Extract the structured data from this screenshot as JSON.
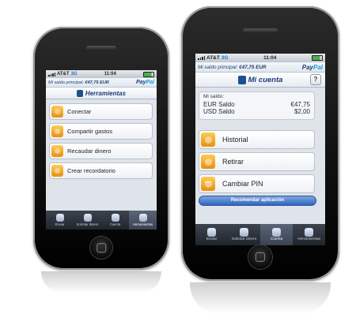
{
  "left_phone": {
    "status": {
      "carrier": "AT&T",
      "network": "3G",
      "time": "11:04"
    },
    "balance": {
      "label": "Mi saldo principal:",
      "amount": "€47,75 EUR"
    },
    "paypal": {
      "part1": "Pay",
      "part2": "Pal"
    },
    "title": "Herramientas",
    "menu": [
      {
        "label": "Conectar",
        "icon": "connect-icon"
      },
      {
        "label": "Compartir gastos",
        "icon": "share-icon"
      },
      {
        "label": "Recaudar dinero",
        "icon": "collect-icon"
      },
      {
        "label": "Crear recordatorio",
        "icon": "reminder-icon"
      }
    ],
    "tabs": [
      {
        "label": "Enviar",
        "icon": "send-icon"
      },
      {
        "label": "Solicitar dinero",
        "icon": "request-icon"
      },
      {
        "label": "Cuenta",
        "icon": "account-icon"
      },
      {
        "label": "Herramientas",
        "icon": "tools-icon",
        "active": true
      }
    ]
  },
  "right_phone": {
    "status": {
      "carrier": "AT&T",
      "network": "3G",
      "time": "11:04"
    },
    "balance": {
      "label": "Mi saldo principal:",
      "amount": "€47,75 EUR"
    },
    "paypal": {
      "part1": "Pay",
      "part2": "Pal"
    },
    "title": "Mi cuenta",
    "help": "?",
    "saldo": {
      "header": "Mi saldo:",
      "rows": [
        {
          "label": "EUR Saldo",
          "value": "€47,75"
        },
        {
          "label": "USD Saldo",
          "value": "$2,00"
        }
      ]
    },
    "menu": [
      {
        "label": "Historial",
        "icon": "history-icon"
      },
      {
        "label": "Retirar",
        "icon": "withdraw-icon"
      },
      {
        "label": "Cambiar PIN",
        "icon": "pin-icon",
        "pin_dots": "****"
      }
    ],
    "recommend": "Recomendar aplicación",
    "tabs": [
      {
        "label": "Enviar",
        "icon": "send-icon"
      },
      {
        "label": "Solicitar dinero",
        "icon": "request-icon"
      },
      {
        "label": "Cuenta",
        "icon": "account-icon",
        "active": true
      },
      {
        "label": "Herramientas",
        "icon": "tools-icon"
      }
    ]
  },
  "colors": {
    "paypal_dark": "#1a3d7c",
    "paypal_light": "#1b9ad6",
    "icon_orange": "#f0a020",
    "tab_dark": "#2c323b"
  }
}
